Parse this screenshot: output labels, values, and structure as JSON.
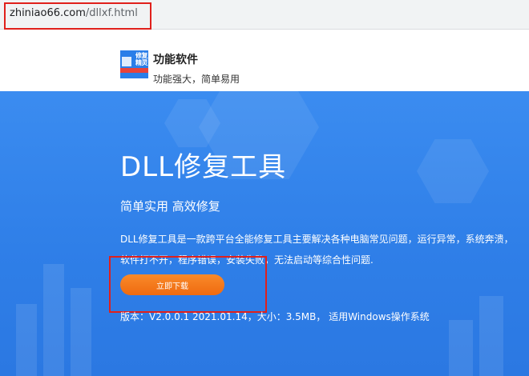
{
  "browser": {
    "url_domain": "zhiniao66.com",
    "url_path": "/dllxf.html"
  },
  "header": {
    "logo_text": "修复精灵",
    "brand_name": "功能软件",
    "slogan": "功能强大，简单易用"
  },
  "hero": {
    "title": "DLL修复工具",
    "subtitle": "简单实用 高效修复",
    "description_line1": "DLL修复工具是一款跨平台全能修复工具主要解决各种电脑常见问题，运行异常，系统奔溃，",
    "description_line2": "软件打不开，程序错误，安装失败，无法启动等综合性问题.",
    "download_label": "立即下载",
    "version_info": "版本：V2.0.0.1 2021.01.14，大小：3.5MB， 适用Windows操作系统"
  },
  "colors": {
    "hero_background": "#2f7fe8",
    "download_button": "#ef6a10",
    "highlight_border": "#e0201b",
    "logo_background": "#2a7ee8"
  },
  "icons": {
    "logo": "app-logo-icon"
  }
}
